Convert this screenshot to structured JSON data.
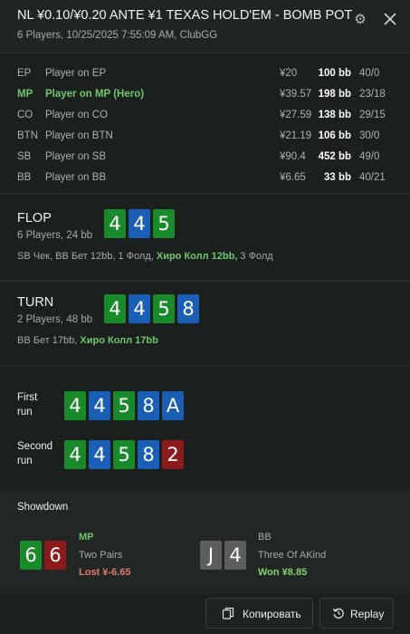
{
  "header": {
    "title": "NL ¥0.10/¥0.20 ANTE ¥1 TEXAS HOLD'EM - BOMB POT",
    "subtitle": "6 Players, 10/25/2025 7:55:09 AM, ClubGG"
  },
  "players": [
    {
      "pos": "EP",
      "name": "Player on EP",
      "money": "¥20",
      "bb": "100 bb",
      "stat": "40/0",
      "hero": false
    },
    {
      "pos": "MP",
      "name": "Player on MP (Hero)",
      "money": "¥39.57",
      "bb": "198 bb",
      "stat": "23/18",
      "hero": true
    },
    {
      "pos": "CO",
      "name": "Player on CO",
      "money": "¥27.59",
      "bb": "138 bb",
      "stat": "29/15",
      "hero": false
    },
    {
      "pos": "BTN",
      "name": "Player on BTN",
      "money": "¥21.19",
      "bb": "106 bb",
      "stat": "30/0",
      "hero": false
    },
    {
      "pos": "SB",
      "name": "Player on SB",
      "money": "¥90.4",
      "bb": "452 bb",
      "stat": "49/0",
      "hero": false
    },
    {
      "pos": "BB",
      "name": "Player on BB",
      "money": "¥6.65",
      "bb": "33 bb",
      "stat": "40/21",
      "hero": false
    }
  ],
  "flop": {
    "title": "FLOP",
    "sub": "6 Players, 24 bb",
    "cards": [
      {
        "rank": "4",
        "color": "green"
      },
      {
        "rank": "4",
        "color": "blue"
      },
      {
        "rank": "5",
        "color": "green"
      }
    ],
    "action_pre": "SB Чек, BB Бет 12bb, 1 Фолд, ",
    "action_hero": "Хиро Колл 12bb,",
    "action_post": " 3 Фолд"
  },
  "turn": {
    "title": "TURN",
    "sub": "2 Players, 48 bb",
    "cards": [
      {
        "rank": "4",
        "color": "green"
      },
      {
        "rank": "4",
        "color": "blue"
      },
      {
        "rank": "5",
        "color": "green"
      },
      {
        "rank": "8",
        "color": "blue"
      }
    ],
    "action_pre": "BB Бет 17bb, ",
    "action_hero": "Хиро Колл 17bb"
  },
  "runs": [
    {
      "label1": "First",
      "label2": "run",
      "cards": [
        {
          "rank": "4",
          "color": "green"
        },
        {
          "rank": "4",
          "color": "blue"
        },
        {
          "rank": "5",
          "color": "green"
        },
        {
          "rank": "8",
          "color": "blue"
        },
        {
          "rank": "A",
          "color": "blue"
        }
      ]
    },
    {
      "label1": "Second",
      "label2": "run",
      "cards": [
        {
          "rank": "4",
          "color": "green"
        },
        {
          "rank": "4",
          "color": "blue"
        },
        {
          "rank": "5",
          "color": "green"
        },
        {
          "rank": "8",
          "color": "blue"
        },
        {
          "rank": "2",
          "color": "red"
        }
      ]
    }
  ],
  "showdown": {
    "title": "Showdown",
    "players": [
      {
        "pos": "MP",
        "hand": "Two Pairs",
        "result": "Lost ¥-6.65",
        "cards": [
          {
            "rank": "6",
            "color": "green"
          },
          {
            "rank": "6",
            "color": "red"
          }
        ]
      },
      {
        "pos": "BB",
        "hand": "Three Of AKind",
        "result": "Won ¥8.85",
        "cards": [
          {
            "rank": "J",
            "color": "gray"
          },
          {
            "rank": "4",
            "color": "gray"
          }
        ]
      }
    ]
  },
  "footer": {
    "copy_label": "Копировать",
    "replay_label": "Replay"
  },
  "colors": {
    "green_card": "#198a2a",
    "blue_card": "#1a5fb4",
    "red_card": "#8b1a1a",
    "gray_card": "#5b5e5d",
    "hero_green": "#6cc86a",
    "lost_red": "#e07a6a",
    "won_green": "#7fd36a"
  }
}
